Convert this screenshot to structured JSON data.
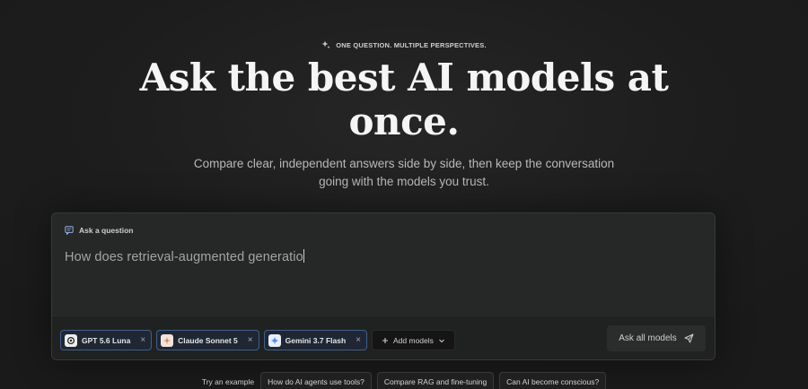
{
  "hero": {
    "eyebrow": "ONE QUESTION. MULTIPLE PERSPECTIVES.",
    "eyebrow_icon": "sparkle-icon",
    "headline_line1": "Ask the best AI models at",
    "headline_line2": "once.",
    "subtitle_line1": "Compare clear, independent answers side by side, then keep the conversation",
    "subtitle_line2": "going with the models you trust."
  },
  "composer": {
    "label": "Ask a question",
    "label_icon": "chat-icon",
    "question_value": "How does retrieval-augmented generatio",
    "selected_models": [
      {
        "name": "GPT 5.6 Luna",
        "icon": "openai-logo-icon",
        "remove": "×"
      },
      {
        "name": "Claude Sonnet 5",
        "icon": "claude-logo-icon",
        "remove": "×"
      },
      {
        "name": "Gemini 3.7 Flash",
        "icon": "gemini-logo-icon",
        "remove": "×"
      }
    ],
    "add_models_label": "Add models",
    "submit_label": "Ask all models"
  },
  "examples": {
    "label": "Try an example",
    "items": [
      "How do AI agents use tools?",
      "Compare RAG and fine-tuning",
      "Can AI become conscious?"
    ]
  },
  "colors": {
    "background": "#1c1c1c",
    "chip_border": "#3f5f8a",
    "claude_orange": "#d97757",
    "gemini_blue": "#4f8ef7"
  }
}
